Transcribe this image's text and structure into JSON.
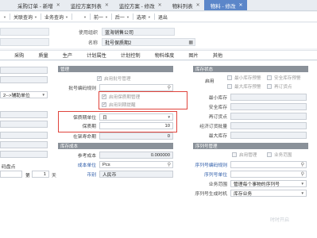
{
  "tabs": [
    {
      "label": "采购订单 - 新增"
    },
    {
      "label": "监控方案列表"
    },
    {
      "label": "监控方案 - 修改"
    },
    {
      "label": "物料列表"
    },
    {
      "label": "物料 - 修改"
    }
  ],
  "toolbar": {
    "items": [
      "关联查询",
      "业务查询",
      "前一",
      "后一",
      "选项",
      "退出"
    ]
  },
  "header": {
    "use_org_label": "使用组织",
    "use_org_value": "蓝海销售公司",
    "name_label": "名称",
    "name_value": "批号保质期2"
  },
  "subtabs": [
    "采购",
    "质量",
    "生产",
    "计划属性",
    "计划控制",
    "物料维度",
    "图片",
    "其他"
  ],
  "left_panel": {
    "truncated_value": "2-->辅助单位",
    "bottom_label": "码盘点",
    "bottom_qty_label": "第",
    "bottom_qty_value": "1",
    "bottom_unit": "天"
  },
  "mgmt_panel": {
    "title": "管理",
    "enable_batch": "启用批号管理",
    "batch_rule_label": "批号编码规则",
    "enable_shelf": "启用保质期管理",
    "enable_expire": "启用到期提醒",
    "shelf_unit_label": "保质期单位",
    "shelf_unit_value": "日",
    "shelf_label": "保质期",
    "shelf_value": "10",
    "remind_label": "在架寿命期",
    "remind_value": "0"
  },
  "cost_panel": {
    "title": "库存成本",
    "ref_cost_label": "参考成本",
    "ref_cost_value": "0.000000",
    "cost_unit_label": "成本单位",
    "cost_unit_value": "Pcs",
    "currency_label": "币别",
    "currency_value": "人民币"
  },
  "stock_panel": {
    "title": "库存状态",
    "enable_label": "启用",
    "min_stock": "最小库存预警",
    "safe_stock": "安全库存预警",
    "reorder": "再订货点",
    "max_stock": "最大库存预警",
    "min_stock_label": "最小库存",
    "safe_stock_label": "安全库存",
    "reorder_label": "再订货点",
    "eoq_label": "经济订货批量",
    "max_stock_label": "最大库存"
  },
  "serial_panel": {
    "title": "序列号管理",
    "enable_serial": "启用管理",
    "unique": "业务范围",
    "rule_label": "序列号编码规则",
    "unit_label": "序列号单位",
    "scope_label": "业务范围",
    "scope_value": "管理每个事物的序列号",
    "gen_label": "序列号生成时机",
    "gen_value": "库存业务"
  },
  "watermark": "时时开启"
}
